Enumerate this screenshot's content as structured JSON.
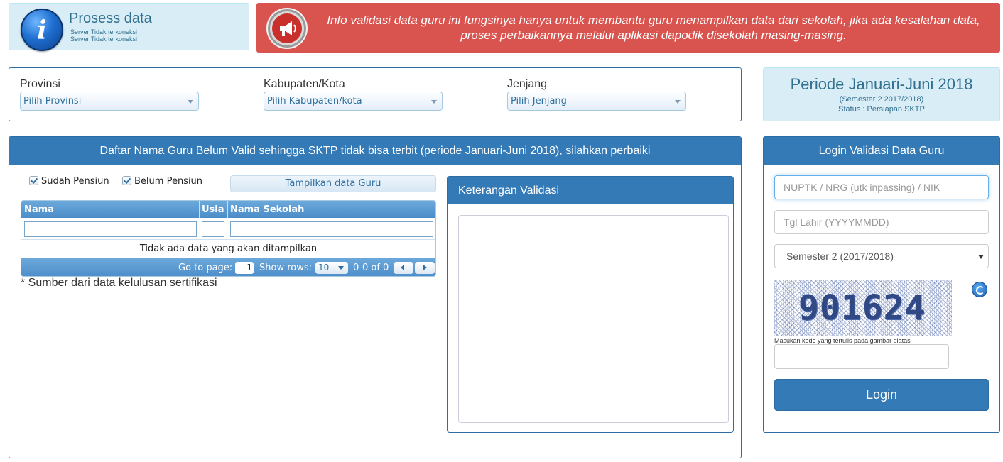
{
  "process": {
    "title": "Prosess data",
    "lines": [
      "Server Tidak terkoneksi",
      "Server Tidak terkoneksi"
    ]
  },
  "banner": {
    "text": "Info validasi data guru ini fungsinya hanya untuk membantu guru menampilkan data dari sekolah, jika ada kesalahan data, proses perbaikannya melalui aplikasi dapodik disekolah masing-masing."
  },
  "filters": {
    "provinsi": {
      "label": "Provinsi",
      "value": "Pilih Provinsi"
    },
    "kabupaten": {
      "label": "Kabupaten/Kota",
      "value": "Pilih Kabupaten/kota"
    },
    "jenjang": {
      "label": "Jenjang",
      "value": "Pilih Jenjang"
    }
  },
  "periode": {
    "title": "Periode Januari-Juni 2018",
    "semester": "(Semester 2 2017/2018)",
    "status": "Status : Persiapan SKTP"
  },
  "list": {
    "heading": "Daftar Nama Guru Belum Valid sehingga SKTP tidak bisa terbit (periode Januari-Juni 2018), silahkan perbaiki",
    "checkbox_sudah": "Sudah Pensiun",
    "checkbox_belum": "Belum Pensiun",
    "show_button": "Tampilkan data Guru",
    "columns": [
      "Nama",
      "Usia",
      "Nama Sekolah"
    ],
    "empty_text": "Tidak ada data yang akan ditampilkan",
    "pager": {
      "goto_label": "Go to page:",
      "page_value": "1",
      "rows_label": "Show rows:",
      "rows_value": "10",
      "range": "0-0 of 0"
    },
    "source_note": "* Sumber dari data kelulusan sertifikasi"
  },
  "keterangan": {
    "heading": "Keterangan Validasi"
  },
  "login": {
    "heading": "Login Validasi Data Guru",
    "nuptk_placeholder": "NUPTK / NRG (utk inpassing) / NIK",
    "tgl_placeholder": "Tgl Lahir (YYYYMMDD)",
    "semester_value": "Semester 2 (2017/2018)",
    "captcha_code": "901624",
    "captcha_hint": "Masukan kode yang tertulis pada gambar diatas",
    "button": "Login"
  },
  "colors": {
    "primary": "#337ab7",
    "info_bg": "#d9edf7",
    "danger": "#d9534f"
  },
  "icons": [
    "info-icon",
    "megaphone-icon",
    "refresh-icon",
    "chevron-down-icon",
    "check-icon"
  ]
}
